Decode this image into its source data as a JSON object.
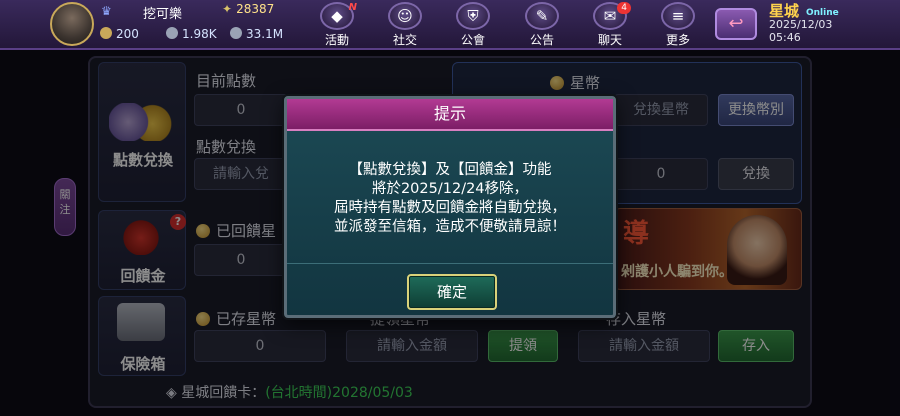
{
  "header": {
    "username": "挖可樂",
    "points_top": "28387",
    "stats": [
      "200",
      "1.98K",
      "33.1M"
    ],
    "nav": [
      {
        "label": "活動",
        "icon": "diamond-icon",
        "badge": "N"
      },
      {
        "label": "社交",
        "icon": "people-icon",
        "badge": ""
      },
      {
        "label": "公會",
        "icon": "shield-icon",
        "badge": ""
      },
      {
        "label": "公告",
        "icon": "megaphone-icon",
        "badge": ""
      },
      {
        "label": "聊天",
        "icon": "chat-icon",
        "badge": "4"
      },
      {
        "label": "更多",
        "icon": "menu-icon",
        "badge": ""
      }
    ],
    "brand": "星城",
    "brand_sub": "Online",
    "date": "2025/12/03",
    "time": "05:46"
  },
  "side_tab": "關注",
  "sections": {
    "exchange": {
      "title": "點數兌換",
      "current_points_label": "目前點數",
      "current_points_value": "0",
      "exchange_label": "點數兌換",
      "exchange_placeholder": "請輸入兌",
      "star_coin_label": "星幣",
      "star_coin_placeholder": "兌換星幣",
      "change_currency_button": "更換幣別",
      "exchange_value": "0",
      "exchange_button": "兌換"
    },
    "rebate": {
      "title": "回饋金",
      "returned_label": "已回饋星",
      "returned_value": "0",
      "badge": "?",
      "banner_big": "導",
      "banner_text": "剁護小人騙到你。"
    },
    "vault": {
      "title": "保險箱",
      "stored_label": "已存星幣",
      "stored_value": "0",
      "withdraw_label": "提領星幣",
      "withdraw_placeholder": "請輸入金額",
      "withdraw_button": "提領",
      "deposit_label": "存入星幣",
      "deposit_placeholder": "請輸入金額",
      "deposit_button": "存入"
    }
  },
  "footer": {
    "label": "◈ 星城回饋卡：",
    "value": "(台北時間)2028/05/03"
  },
  "modal": {
    "title": "提示",
    "lines": [
      "【點數兌換】及【回饋金】功能",
      "將於2025/12/24移除，",
      "屆時持有點數及回饋金將自動兌換，",
      "並派發至信箱，造成不便敬請見諒！"
    ],
    "ok_button": "確定"
  },
  "colors": {
    "modal_header": "#b23a93",
    "modal_body": "#1c4a55",
    "accent_gold": "#ffd34d",
    "green_text": "#3fd35a"
  }
}
